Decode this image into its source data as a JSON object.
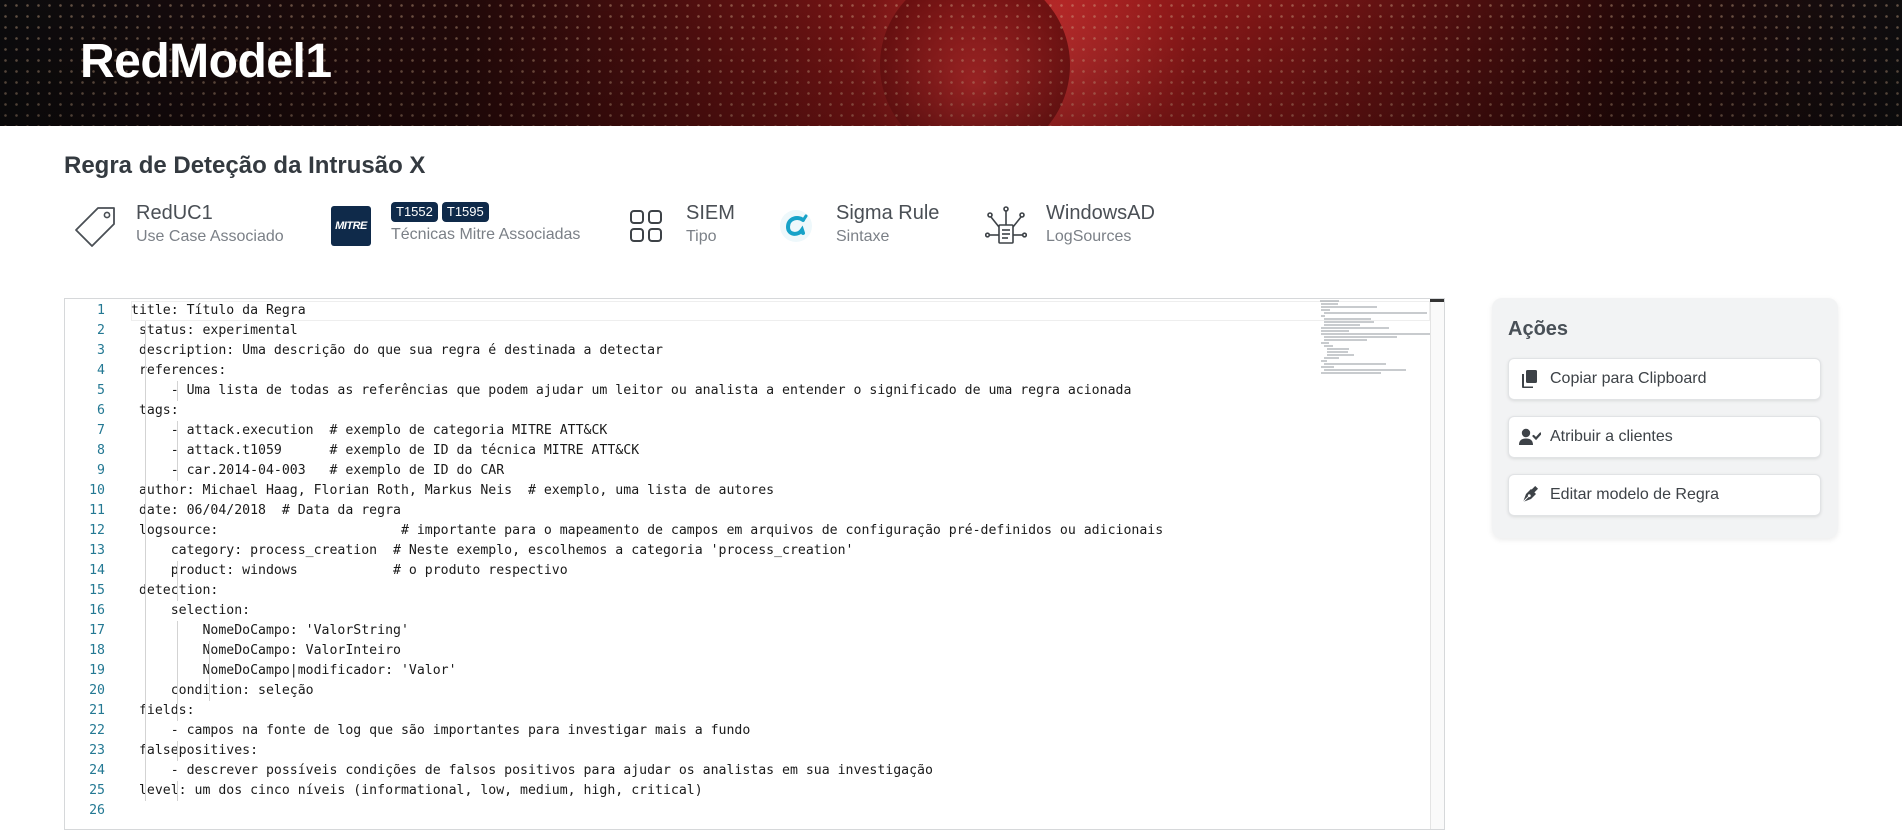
{
  "banner": {
    "title": "RedModel1"
  },
  "page": {
    "title": "Regra de Deteção da Intrusão X"
  },
  "meta": {
    "use_case": {
      "value": "RedUC1",
      "label": "Use Case Associado",
      "icon": "tag-icon"
    },
    "mitre": {
      "logo": "MITRE",
      "badges": [
        "T1552",
        "T1595"
      ],
      "label": "Técnicas Mitre Associadas",
      "icon": "mitre-logo"
    },
    "type": {
      "value": "SIEM",
      "label": "Tipo",
      "icon": "grid-icon"
    },
    "syntax": {
      "value": "Sigma Rule",
      "label": "Sintaxe",
      "icon": "sigma-icon"
    },
    "logsources": {
      "value": "WindowsAD",
      "label": "LogSources",
      "icon": "network-document-icon"
    }
  },
  "editor": {
    "lines": [
      "title: Título da Regra",
      " status: experimental",
      " description: Uma descrição do que sua regra é destinada a detectar",
      " references:",
      "     - Uma lista de todas as referências que podem ajudar um leitor ou analista a entender o significado de uma regra acionada",
      " tags:",
      "     - attack.execution  # exemplo de categoria MITRE ATT&CK",
      "     - attack.t1059      # exemplo de ID da técnica MITRE ATT&CK",
      "     - car.2014-04-003   # exemplo de ID do CAR",
      " author: Michael Haag, Florian Roth, Markus Neis  # exemplo, uma lista de autores",
      " date: 06/04/2018  # Data da regra",
      " logsource:                       # importante para o mapeamento de campos em arquivos de configuração pré-definidos ou adicionais",
      "     category: process_creation  # Neste exemplo, escolhemos a categoria 'process_creation'",
      "     product: windows            # o produto respectivo",
      " detection:",
      "     selection:",
      "         NomeDoCampo: 'ValorString'",
      "         NomeDoCampo: ValorInteiro",
      "         NomeDoCampo|modificador: 'Valor'",
      "     condition: seleção",
      " fields:",
      "     - campos na fonte de log que são importantes para investigar mais a fundo",
      " falsepositives:",
      "     - descrever possíveis condições de falsos positivos para ajudar os analistas em sua investigação",
      " level: um dos cinco níveis (informational, low, medium, high, critical)",
      ""
    ],
    "line_numbers": [
      "1",
      "2",
      "3",
      "4",
      "5",
      "6",
      "7",
      "8",
      "9",
      "10",
      "11",
      "12",
      "13",
      "14",
      "15",
      "16",
      "17",
      "18",
      "19",
      "20",
      "21",
      "22",
      "23",
      "24",
      "25",
      "26"
    ]
  },
  "actions": {
    "title": "Ações",
    "buttons": [
      {
        "label": "Copiar para Clipboard",
        "icon": "copy-icon"
      },
      {
        "label": "Atribuir a clientes",
        "icon": "user-check-icon"
      },
      {
        "label": "Editar modelo de Regra",
        "icon": "pen-nib-icon"
      }
    ]
  },
  "colors": {
    "mitre_navy": "#0f2a4a",
    "line_number": "#237893",
    "sigma_cyan": "#17a2c8"
  }
}
